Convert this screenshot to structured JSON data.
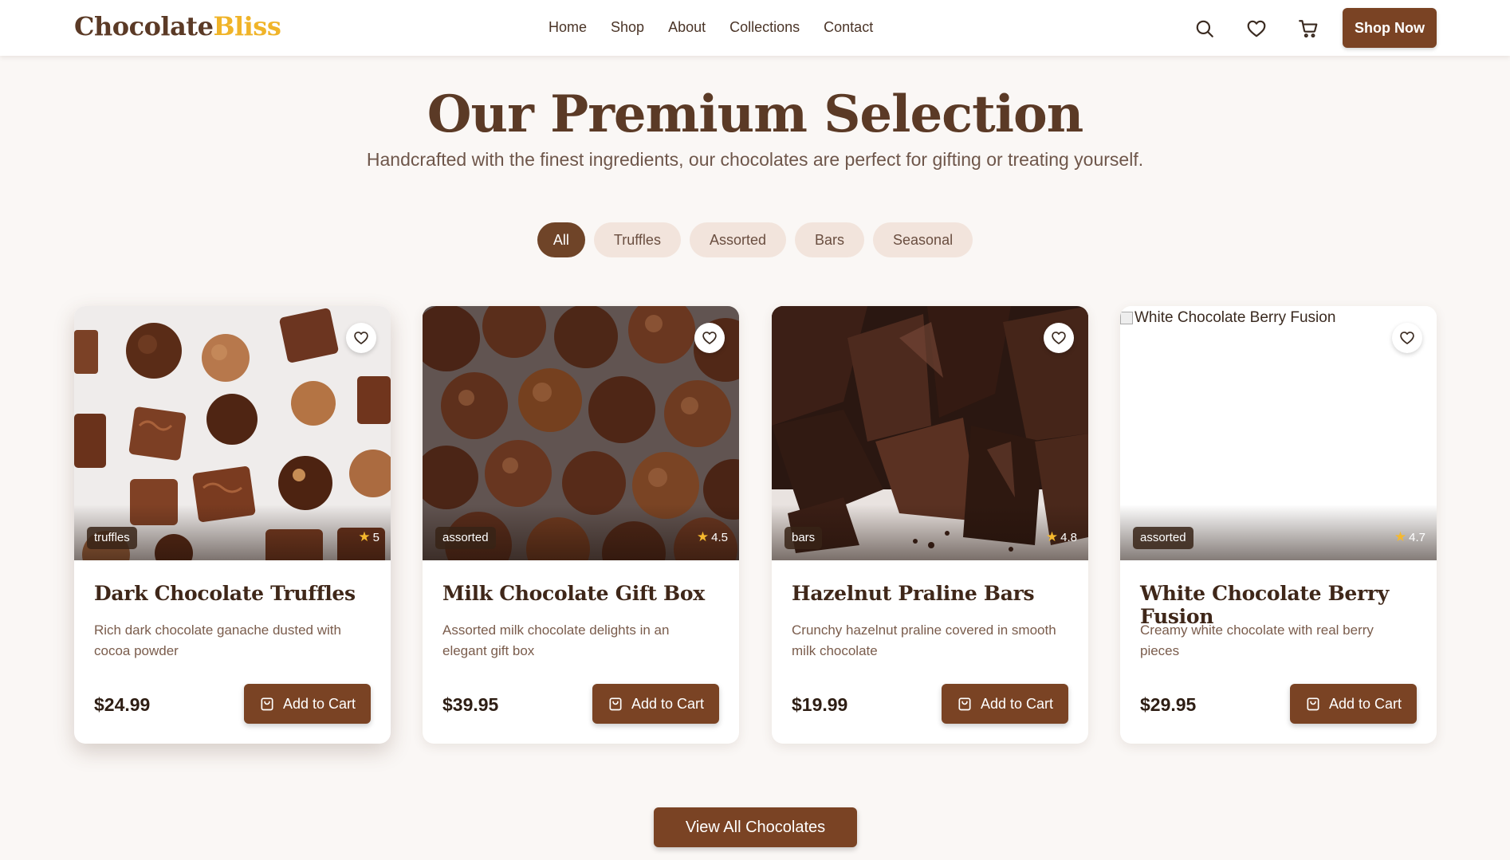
{
  "brand": {
    "name_part1": "Chocolate",
    "name_part2": "Bliss",
    "accent_color": "#f0b429",
    "primary_color": "#7a4324"
  },
  "nav": {
    "links": [
      "Home",
      "Shop",
      "About",
      "Collections",
      "Contact"
    ],
    "icons": [
      "search-icon",
      "heart-icon",
      "cart-icon"
    ],
    "cta_label": "Shop Now"
  },
  "hero": {
    "title": "Our Premium Selection",
    "subtitle": "Handcrafted with the finest ingredients, our chocolates are perfect for gifting or treating yourself."
  },
  "filters": {
    "options": [
      "All",
      "Truffles",
      "Assorted",
      "Bars",
      "Seasonal"
    ],
    "active": "All"
  },
  "products": [
    {
      "name": "Dark Chocolate Truffles",
      "description": "Rich dark chocolate ganache dusted with cocoa powder",
      "category": "truffles",
      "rating": "5",
      "price": "$24.99",
      "button_label": "Add to Cart",
      "image_alt": ""
    },
    {
      "name": "Milk Chocolate Gift Box",
      "description": "Assorted milk chocolate delights in an elegant gift box",
      "category": "assorted",
      "rating": "4.5",
      "price": "$39.95",
      "button_label": "Add to Cart",
      "image_alt": ""
    },
    {
      "name": "Hazelnut Praline Bars",
      "description": "Crunchy hazelnut praline covered in smooth milk chocolate",
      "category": "bars",
      "rating": "4.8",
      "price": "$19.99",
      "button_label": "Add to Cart",
      "image_alt": ""
    },
    {
      "name": "White Chocolate Berry Fusion",
      "description": "Creamy white chocolate with real berry pieces",
      "category": "assorted",
      "rating": "4.7",
      "price": "$29.95",
      "button_label": "Add to Cart",
      "image_alt": "White Chocolate Berry Fusion"
    }
  ],
  "view_all_label": "View All Chocolates"
}
